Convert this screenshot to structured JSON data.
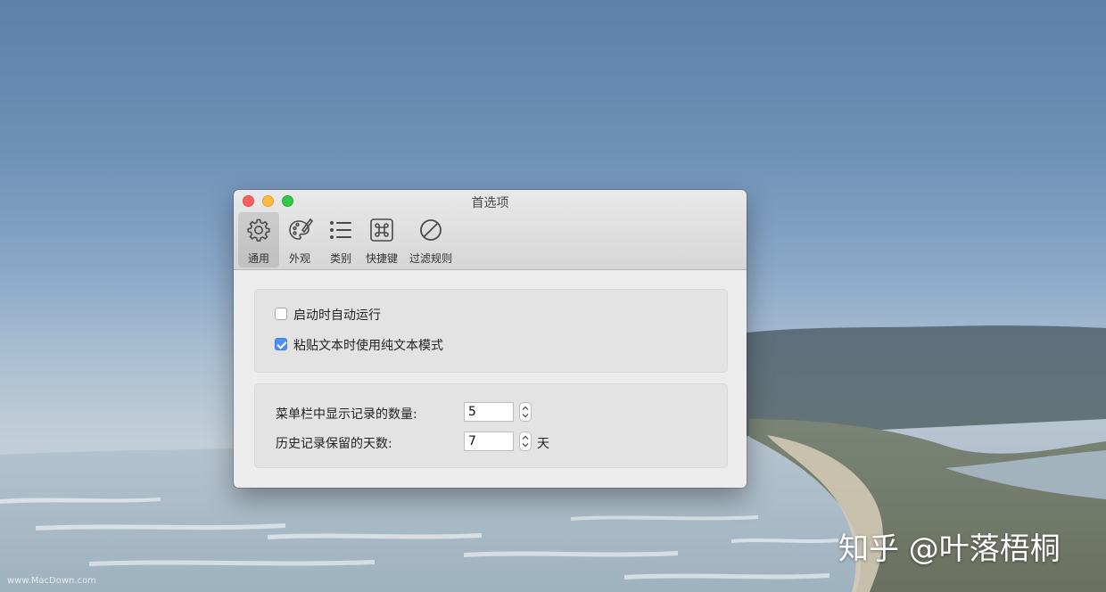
{
  "window": {
    "title": "首选项",
    "controls": [
      "close",
      "minimize",
      "zoom"
    ]
  },
  "toolbar": {
    "items": [
      {
        "label": "通用",
        "icon": "gear-icon",
        "active": true
      },
      {
        "label": "外观",
        "icon": "palette-icon",
        "active": false
      },
      {
        "label": "类别",
        "icon": "list-icon",
        "active": false
      },
      {
        "label": "快捷键",
        "icon": "command-key-icon",
        "active": false
      },
      {
        "label": "过滤规则",
        "icon": "prohibited-icon",
        "active": false
      }
    ]
  },
  "general": {
    "launch_at_login": {
      "label": "启动时自动运行",
      "checked": false
    },
    "paste_plain_text": {
      "label": "粘贴文本时使用纯文本模式",
      "checked": true
    },
    "menubar_count": {
      "label": "菜单栏中显示记录的数量:",
      "value": "5"
    },
    "history_days": {
      "label": "历史记录保留的天数:",
      "value": "7",
      "unit": "天"
    }
  },
  "overlay": {
    "watermark": "知乎 @叶落梧桐",
    "corner_mark": "www.MacDown.com"
  },
  "colors": {
    "close": "#fc605c",
    "minimize": "#fdbc40",
    "zoom": "#34c84a",
    "checkbox_accent": "#4f8ff7"
  }
}
